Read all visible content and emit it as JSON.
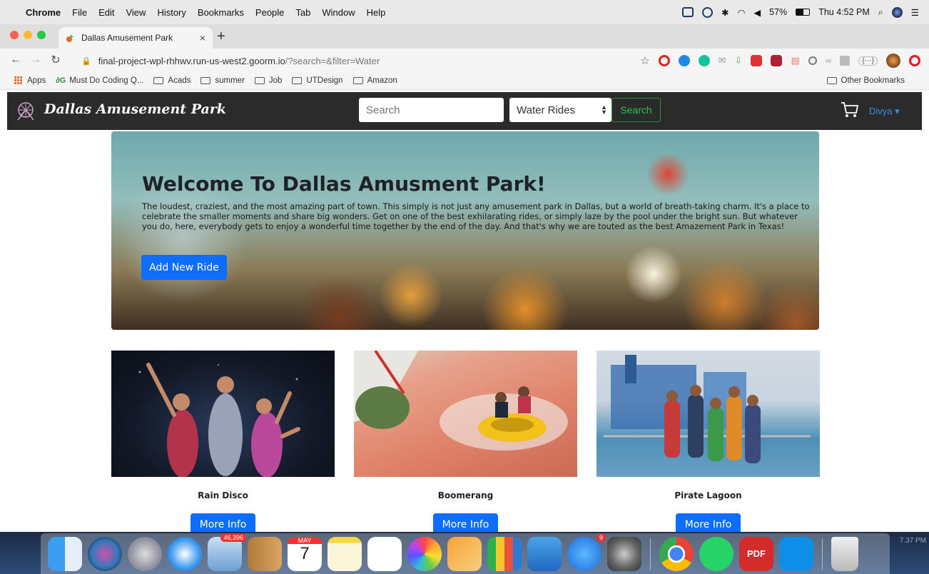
{
  "menubar": {
    "app": "Chrome",
    "items": [
      "File",
      "Edit",
      "View",
      "History",
      "Bookmarks",
      "People",
      "Tab",
      "Window",
      "Help"
    ],
    "battery": "57%",
    "clock": "Thu 4:52 PM"
  },
  "browser": {
    "tab_title": "Dallas Amusement Park",
    "tab_close": "×",
    "new_tab": "+",
    "url_host": "final-project-wpl-rhhwv.run-us-west2.goorm.io",
    "url_path": "/?search=&filter=Water",
    "ext_text": "{⋯}"
  },
  "bookmarks": {
    "items": [
      "Apps",
      "Must Do Coding Q...",
      "Acads",
      "summer",
      "Job",
      "UTDesign",
      "Amazon"
    ],
    "other": "Other Bookmarks"
  },
  "navbar": {
    "brand": "Dallas Amusement Park",
    "search_placeholder": "Search",
    "filter_selected": "Water Rides",
    "search_button": "Search",
    "user": "Divya ▾"
  },
  "hero": {
    "title": "Welcome To Dallas Amusment Park!",
    "text": "The loudest, craziest, and the most amazing part of town. This simply is not just any amusement park in Dallas, but a world of breath-taking charm. It's a place to celebrate the smaller moments and share big wonders. Get on one of the best exhilarating rides, or simply laze by the pool under the bright sun. But whatever you do, here, everybody gets to enjoy a wonderful time together by the end of the day. And that's why we are touted as the best Amazement Park in Texas!",
    "button": "Add New Ride"
  },
  "rides": [
    {
      "name": "Rain Disco",
      "button": "More Info"
    },
    {
      "name": "Boomerang",
      "button": "More Info"
    },
    {
      "name": "Pirate Lagoon",
      "button": "More Info"
    }
  ],
  "dock": {
    "mail_badge": "46,396",
    "calendar_month": "MAY",
    "calendar_day": "7",
    "appstore_badge": "9",
    "pdf_label": "PDF",
    "time_partial": "7.37 PM"
  },
  "colors": {
    "primary": "#0d6efd",
    "navbar": "#2b2b2b",
    "search_green": "#2fbf4a",
    "user_blue": "#3a8de0"
  }
}
